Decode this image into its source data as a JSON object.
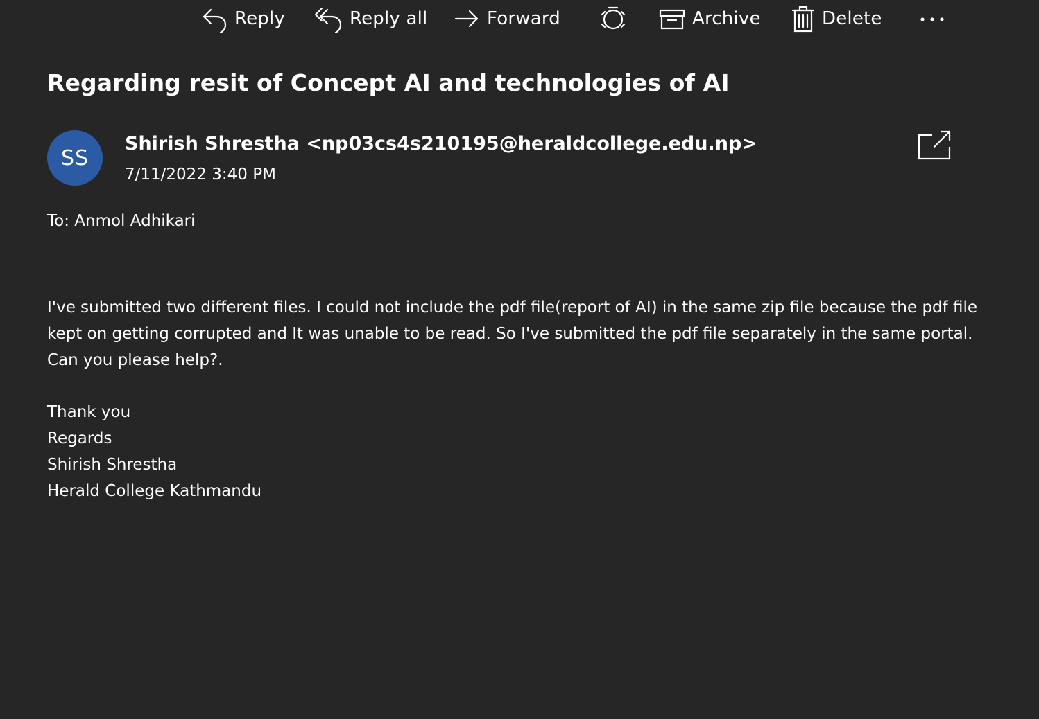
{
  "toolbar": {
    "reply_label": "Reply",
    "reply_all_label": "Reply all",
    "forward_label": "Forward",
    "archive_label": "Archive",
    "delete_label": "Delete",
    "icons": [
      "reply-icon",
      "reply-all-icon",
      "forward-icon",
      "sweep-icon",
      "archive-icon",
      "delete-icon",
      "more-icon"
    ]
  },
  "message": {
    "subject": "Regarding resit of Concept AI and technologies of AI",
    "avatar_initials": "SS",
    "avatar_color": "#2c5ba5",
    "sender": "Shirish Shrestha <np03cs4s210195@heraldcollege.edu.np>",
    "date": "7/11/2022 3:40 PM",
    "to_line": "To: Anmol Adhikari",
    "body_paragraph": "I've submitted two different files. I could not include the pdf file(report of AI) in the same zip file because the pdf file kept on getting corrupted and It was unable to be read. So I've submitted the pdf file separately in the same portal.  Can you please help?.",
    "signature": [
      "Thank you",
      "Regards",
      "Shirish Shrestha",
      "Herald College Kathmandu"
    ]
  },
  "colors": {
    "background": "#262626",
    "text": "#ffffff"
  }
}
